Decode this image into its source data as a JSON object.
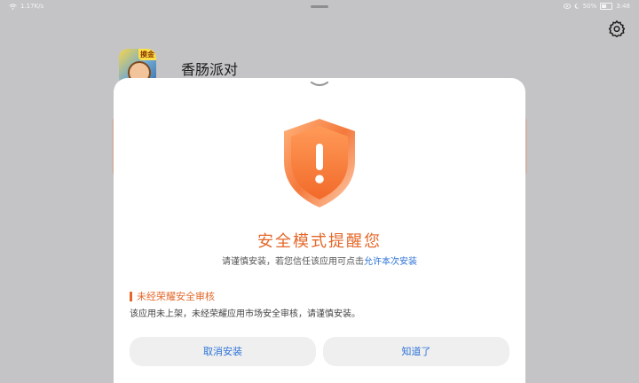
{
  "status_bar": {
    "left_text": "1.17K/s",
    "right_text": "50%",
    "time": "3:48"
  },
  "app": {
    "name": "香肠派对",
    "icon_badge": "摸金"
  },
  "dialog": {
    "title": "安全模式提醒您",
    "subtitle_prefix": "请谨慎安装，若您信任该应用可点击",
    "subtitle_link": "允许本次安装",
    "warning_heading": "未经荣耀安全审核",
    "warning_text": "该应用未上架，未经荣耀应用市场安全审核，请谨慎安装。",
    "cancel_label": "取消安装",
    "ok_label": "知道了"
  },
  "colors": {
    "accent": "#e4682a",
    "link": "#2f74d6",
    "background_dim": "#c4c4c6"
  },
  "icons": [
    "wifi-icon",
    "moon-icon",
    "battery-icon",
    "settings-icon",
    "shield-warning-icon",
    "chevron-down-icon"
  ]
}
